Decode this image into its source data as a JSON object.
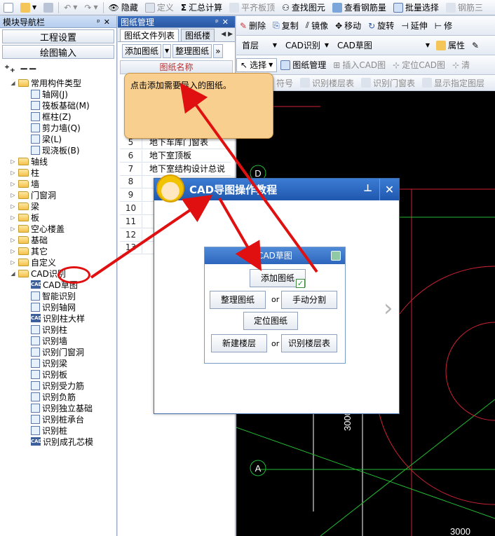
{
  "toolbar": {
    "items": [
      {
        "label": "隐藏",
        "icon": "eye-icon",
        "dim": false
      },
      {
        "label": "定义",
        "icon": "define-icon",
        "dim": true
      },
      {
        "label": "汇总计算",
        "icon": "sigma-icon",
        "dim": false
      },
      {
        "label": "平齐板顶",
        "icon": "align-icon",
        "dim": true
      },
      {
        "label": "查找图元",
        "icon": "binoculars-icon",
        "dim": false
      },
      {
        "label": "查看钢筋量",
        "icon": "view-rebar-icon",
        "dim": false
      },
      {
        "label": "批量选择",
        "icon": "batch-select-icon",
        "dim": false
      },
      {
        "label": "钢筋三",
        "icon": "rebar-3d-icon",
        "dim": true
      }
    ]
  },
  "nav_panel": {
    "title": "模块导航栏",
    "btn_project": "工程设置",
    "btn_drawing": "绘图输入",
    "tree": [
      {
        "label": "常用构件类型",
        "kind": "folder",
        "level": 0,
        "expanded": true
      },
      {
        "label": "轴网(J)",
        "kind": "leaf",
        "level": 1
      },
      {
        "label": "筏板基础(M)",
        "kind": "leaf",
        "level": 1
      },
      {
        "label": "框柱(Z)",
        "kind": "leaf",
        "level": 1
      },
      {
        "label": "剪力墙(Q)",
        "kind": "leaf",
        "level": 1
      },
      {
        "label": "梁(L)",
        "kind": "leaf",
        "level": 1
      },
      {
        "label": "现浇板(B)",
        "kind": "leaf",
        "level": 1
      },
      {
        "label": "轴线",
        "kind": "folder",
        "level": 0
      },
      {
        "label": "柱",
        "kind": "folder",
        "level": 0
      },
      {
        "label": "墙",
        "kind": "folder",
        "level": 0
      },
      {
        "label": "门窗洞",
        "kind": "folder",
        "level": 0
      },
      {
        "label": "梁",
        "kind": "folder",
        "level": 0
      },
      {
        "label": "板",
        "kind": "folder",
        "level": 0
      },
      {
        "label": "空心楼盖",
        "kind": "folder",
        "level": 0
      },
      {
        "label": "基础",
        "kind": "folder",
        "level": 0
      },
      {
        "label": "其它",
        "kind": "folder",
        "level": 0
      },
      {
        "label": "自定义",
        "kind": "folder",
        "level": 0
      },
      {
        "label": "CAD识别",
        "kind": "folder",
        "level": 0,
        "expanded": true
      },
      {
        "label": "CAD草图",
        "kind": "cad",
        "level": 1
      },
      {
        "label": "智能识别",
        "kind": "leaf",
        "level": 1
      },
      {
        "label": "识别轴网",
        "kind": "leaf",
        "level": 1
      },
      {
        "label": "识别柱大样",
        "kind": "cad",
        "level": 1
      },
      {
        "label": "识别柱",
        "kind": "leaf",
        "level": 1
      },
      {
        "label": "识别墙",
        "kind": "leaf",
        "level": 1
      },
      {
        "label": "识别门窗洞",
        "kind": "leaf",
        "level": 1
      },
      {
        "label": "识别梁",
        "kind": "leaf",
        "level": 1
      },
      {
        "label": "识别板",
        "kind": "leaf",
        "level": 1
      },
      {
        "label": "识别受力筋",
        "kind": "leaf",
        "level": 1
      },
      {
        "label": "识别负筋",
        "kind": "leaf",
        "level": 1
      },
      {
        "label": "识别独立基础",
        "kind": "leaf",
        "level": 1
      },
      {
        "label": "识别桩承台",
        "kind": "leaf",
        "level": 1
      },
      {
        "label": "识别桩",
        "kind": "leaf",
        "level": 1
      },
      {
        "label": "识别成孔芯模",
        "kind": "cad",
        "level": 1
      }
    ]
  },
  "mgmt_panel": {
    "title": "图纸管理",
    "tab_active": "图纸文件列表",
    "tab_inactive": "图纸楼",
    "btn_add": "添加图纸",
    "btn_arrange": "整理图纸",
    "col_name": "图纸名称",
    "rows": [
      {
        "num": "5",
        "name": "地下车库门窗表"
      },
      {
        "num": "6",
        "name": "地下室顶板"
      },
      {
        "num": "7",
        "name": "地下室结构设计总说"
      },
      {
        "num": "8",
        "name": ""
      },
      {
        "num": "9",
        "name": ""
      },
      {
        "num": "10",
        "name": ""
      },
      {
        "num": "11",
        "name": ""
      },
      {
        "num": "12",
        "name": ""
      },
      {
        "num": "13",
        "name": ""
      }
    ]
  },
  "work_toolbar": {
    "row1": [
      "删除",
      "复制",
      "镜像",
      "移动",
      "旋转",
      "延伸",
      "修"
    ],
    "floor": "首层",
    "cad_recog": "CAD识别",
    "cad_sketch": "CAD草图",
    "attr": "属性",
    "row3": [
      "选择",
      "图纸管理",
      "插入CAD图",
      "定位CAD图",
      "清"
    ],
    "row4": [
      "符号",
      "识别楼层表",
      "识别门窗表",
      "显示指定图层"
    ]
  },
  "canvas": {
    "axis_d": "D",
    "axis_a": "A",
    "dim_vertical": "3000",
    "dim_bottom": "3000"
  },
  "tooltip": {
    "text": "点击添加需要导入的图纸。"
  },
  "dialog": {
    "title": "CAD导图操作教程",
    "inner_title": "CAD草图",
    "btn_add": "添加图纸",
    "btn_arrange": "整理图纸",
    "btn_split": "手动分割",
    "btn_locate": "定位图纸",
    "btn_new_floor": "新建楼层",
    "btn_recog_floor": "识别楼层表",
    "or": "or",
    "check": "✓"
  },
  "colors": {
    "accent": "#2a5aa8",
    "arrow": "#e01010",
    "tooltip": "#f9cf8f",
    "canvas": "#000000"
  }
}
